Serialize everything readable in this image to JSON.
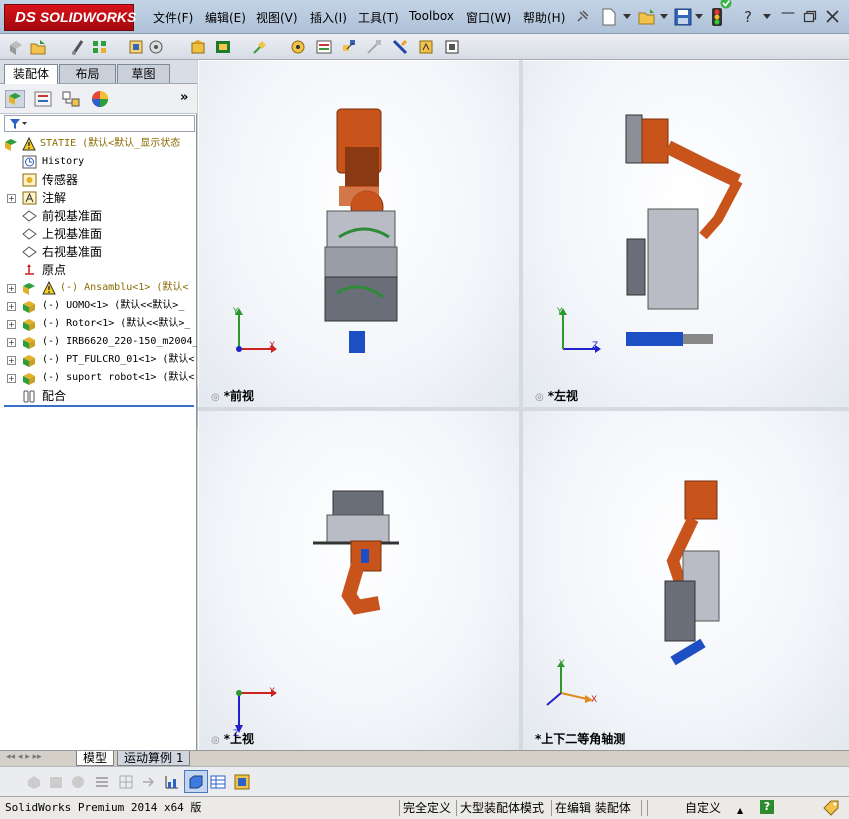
{
  "app": {
    "logo_prefix": "DS",
    "logo_text": "SOLIDWORKS"
  },
  "menu": [
    "文件(F)",
    "编辑(E)",
    "视图(V)",
    "插入(I)",
    "工具(T)",
    "Toolbox",
    "窗口(W)",
    "帮助(H)"
  ],
  "left_tabs": [
    "装配体",
    "布局",
    "草图"
  ],
  "expand_label": "»",
  "tree": [
    {
      "label": "STATIE  (默认<默认_显示状态",
      "icon": "assembly-warning-icon",
      "expander": "",
      "indent": 0,
      "color": "#8a6a00"
    },
    {
      "label": "History",
      "icon": "history-icon",
      "expander": "",
      "indent": 1,
      "color": "#000000"
    },
    {
      "label": "传感器",
      "icon": "sensor-icon",
      "expander": "",
      "indent": 1,
      "color": "#000000"
    },
    {
      "label": "注解",
      "icon": "annotation-icon",
      "expander": "+",
      "indent": 1,
      "color": "#000000"
    },
    {
      "label": "前视基准面",
      "icon": "plane-icon",
      "expander": "",
      "indent": 1,
      "color": "#000000"
    },
    {
      "label": "上视基准面",
      "icon": "plane-icon",
      "expander": "",
      "indent": 1,
      "color": "#000000"
    },
    {
      "label": "右视基准面",
      "icon": "plane-icon",
      "expander": "",
      "indent": 1,
      "color": "#000000"
    },
    {
      "label": "原点",
      "icon": "origin-icon",
      "expander": "",
      "indent": 1,
      "color": "#000000"
    },
    {
      "label": "(-) Ansamblu<1> (默认<",
      "icon": "subassembly-warning-icon",
      "expander": "+",
      "indent": 1,
      "color": "#8a6a00"
    },
    {
      "label": "(-) UOMO<1> (默认<<默认>_",
      "icon": "subassembly-icon",
      "expander": "+",
      "indent": 1,
      "color": "#000000"
    },
    {
      "label": "(-) Rotor<1> (默认<<默认>_",
      "icon": "subassembly-icon",
      "expander": "+",
      "indent": 1,
      "color": "#000000"
    },
    {
      "label": "(-) IRB6620_220-150_m2004_",
      "icon": "subassembly-icon",
      "expander": "+",
      "indent": 1,
      "color": "#000000"
    },
    {
      "label": "(-) PT_FULCRO_01<1> (默认<",
      "icon": "subassembly-icon",
      "expander": "+",
      "indent": 1,
      "color": "#000000"
    },
    {
      "label": "(-) suport robot<1> (默认<",
      "icon": "subassembly-icon",
      "expander": "+",
      "indent": 1,
      "color": "#000000"
    },
    {
      "label": "配合",
      "icon": "mates-icon",
      "expander": "",
      "indent": 1,
      "color": "#000000"
    }
  ],
  "views": [
    {
      "label": "*前视",
      "h": "X",
      "v": "Y"
    },
    {
      "label": "*左视",
      "h": "Z",
      "v": "Y"
    },
    {
      "label": "*上视",
      "h": "X",
      "v": "Z"
    },
    {
      "label": "*上下二等角轴测",
      "h": "X",
      "v": "Y"
    }
  ],
  "bottom_tabs": [
    "模型",
    "运动算例 1"
  ],
  "status": {
    "product": "SolidWorks Premium 2014 x64 版",
    "definition": "完全定义",
    "mode": "大型装配体模式",
    "editing": "在编辑 装配体",
    "units": "自定义",
    "up_arrow": "▲",
    "help": "?"
  },
  "colors": {
    "robot_orange": "#c8541c",
    "fixture_gray": "#6a6e78",
    "accent_blue": "#1c4fc4",
    "green_part": "#2f8a3a"
  }
}
